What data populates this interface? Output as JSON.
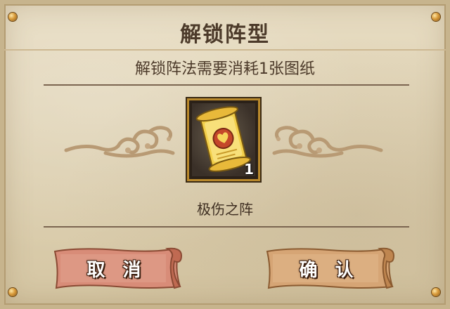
{
  "dialog": {
    "title": "解锁阵型",
    "message": "解锁阵法需要消耗1张图纸"
  },
  "item": {
    "icon": "blueprint-scroll-icon",
    "count": "1",
    "name": "极伤之阵"
  },
  "buttons": {
    "cancel_label": "取 消",
    "confirm_label": "确 认"
  },
  "colors": {
    "parchment": "#e1d5b8",
    "text": "#4c3a2a",
    "frame_gold": "#b9892c",
    "cancel_button": "#d88c78",
    "confirm_button": "#d6a575"
  }
}
